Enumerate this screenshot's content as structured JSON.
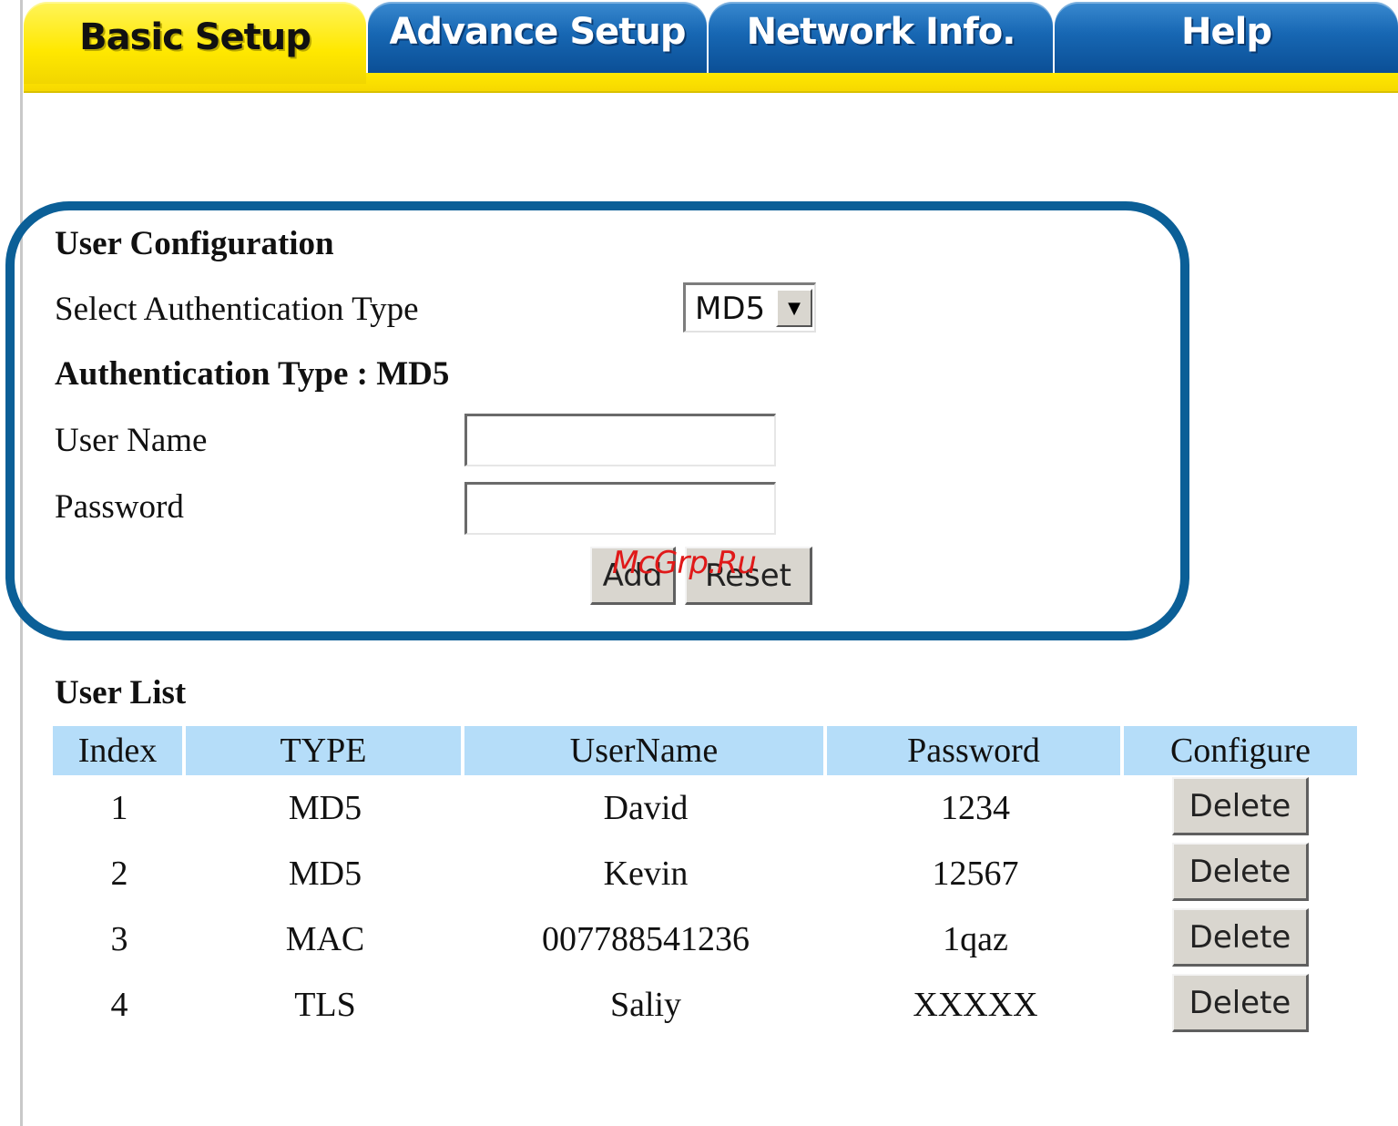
{
  "tabs": [
    {
      "label": "Basic Setup",
      "active": true
    },
    {
      "label": "Advance Setup",
      "active": false
    },
    {
      "label": "Network Info.",
      "active": false
    },
    {
      "label": "Help",
      "active": false
    }
  ],
  "user_config": {
    "title": "User Configuration",
    "auth_select_label": "Select Authentication Type",
    "auth_select_value": "MD5",
    "auth_type_heading": "Authentication Type : MD5",
    "username_label": "User Name",
    "username_value": "",
    "password_label": "Password",
    "password_value": "",
    "add_label": "Add",
    "reset_label": "Reset"
  },
  "watermark": "McGrp.Ru",
  "user_list": {
    "title": "User List",
    "columns": [
      "Index",
      "TYPE",
      "UserName",
      "Password",
      "Configure"
    ],
    "rows": [
      {
        "index": "1",
        "type": "MD5",
        "username": "David",
        "password": "1234",
        "action": "Delete"
      },
      {
        "index": "2",
        "type": "MD5",
        "username": "Kevin",
        "password": "12567",
        "action": "Delete"
      },
      {
        "index": "3",
        "type": "MAC",
        "username": "007788541236",
        "password": "1qaz",
        "action": "Delete"
      },
      {
        "index": "4",
        "type": "TLS",
        "username": "Saliy",
        "password": "XXXXX",
        "action": "Delete"
      }
    ]
  },
  "colors": {
    "active_tab": "#ffe800",
    "inactive_tab": "#1767b3",
    "highlight_border": "#0b5f97",
    "table_header": "#b5ddf9"
  }
}
